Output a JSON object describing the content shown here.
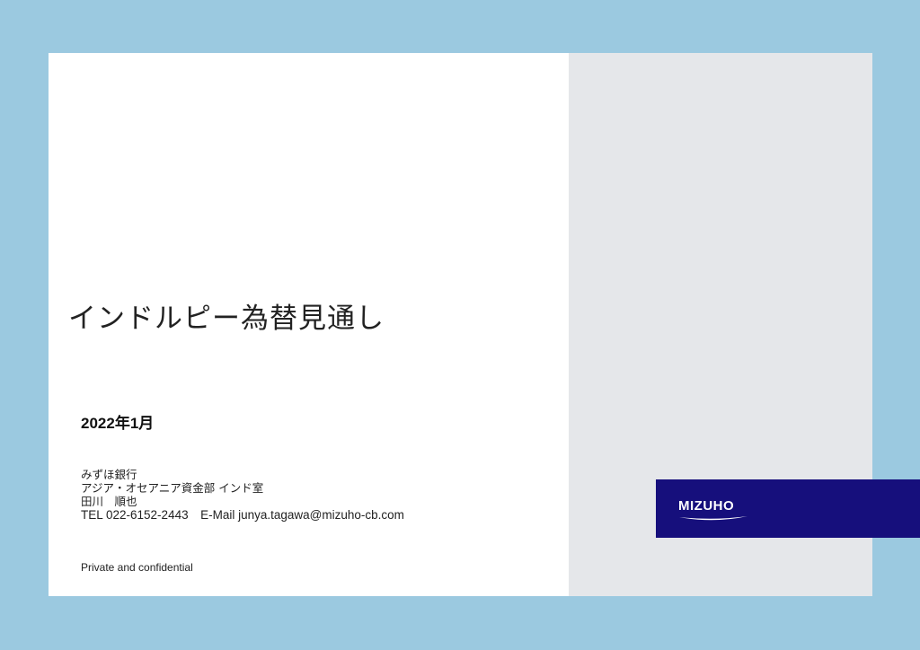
{
  "cover": {
    "title": "インドルピー為替見通し",
    "date": "2022年1月",
    "contact": {
      "bank": "みずほ銀行",
      "department": "アジア・オセアニア資金部 インド室",
      "name": "田川　順也",
      "tel_email": "TEL 022-6152-2443　E-Mail junya.tagawa@mizuho-cb.com"
    },
    "confidential": "Private and confidential"
  },
  "logo": {
    "text": "MIZUHO",
    "background": "#160f7c"
  },
  "colors": {
    "frame": "#9bc9e0",
    "side_panel": "#e5e7ea"
  }
}
